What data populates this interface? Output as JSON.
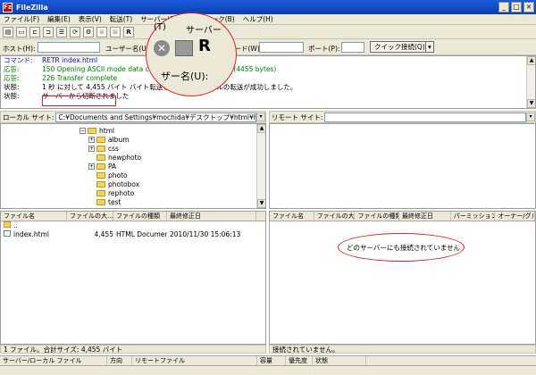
{
  "window": {
    "title": "FileZilla",
    "icon_text": "Fz",
    "buttons": [
      "_",
      "□",
      "×"
    ]
  },
  "menu": [
    "ファイル(F)",
    "編集(E)",
    "表示(V)",
    "転送(T)",
    "サーバー(S)",
    "ブックマーク(B)",
    "ヘルプ(H)"
  ],
  "toolbar": {
    "disconnect_letter": "R"
  },
  "quickconnect": {
    "host_label": "ホスト(H):",
    "user_label": "ユーザー名(U):",
    "pass_label": "パスワード(W):",
    "port_label": "ポート(P):",
    "button": "クイック接続(Q)"
  },
  "log": [
    {
      "kind": "コマンド:",
      "text": "RETR index.html",
      "class": "c-cmd"
    },
    {
      "kind": "応答:",
      "text": "150 Opening ASCII mode data connection for index.html (4455 bytes)",
      "class": "c-ok"
    },
    {
      "kind": "応答:",
      "text": "226 Transfer complete",
      "class": "c-ok"
    },
    {
      "kind": "状態:",
      "text": "1 秒 に対して 4,455 バイト バイト転送しました。ファイルの転送が成功しました。",
      "class": "c-st"
    },
    {
      "kind": "状態:",
      "text": "サーバーから切断されました",
      "class": "c-st"
    }
  ],
  "zoom": {
    "menu_hint": "(T)",
    "menu_title": "サーバー",
    "letter": "R",
    "caption": "ザー名(U):"
  },
  "local": {
    "site_label": "ローカル サイト:",
    "path": "C:¥Documents and Settings¥mochida¥デスクトップ¥html¥html¥test¥",
    "tree": [
      {
        "name": "html",
        "depth": 0,
        "expander": "−"
      },
      {
        "name": "album",
        "depth": 1,
        "expander": "+"
      },
      {
        "name": "css",
        "depth": 1,
        "expander": "+"
      },
      {
        "name": "newphoto",
        "depth": 1,
        "expander": ""
      },
      {
        "name": "PA",
        "depth": 1,
        "expander": "+"
      },
      {
        "name": "photo",
        "depth": 1,
        "expander": ""
      },
      {
        "name": "photobox",
        "depth": 1,
        "expander": ""
      },
      {
        "name": "rephoto",
        "depth": 1,
        "expander": ""
      },
      {
        "name": "test",
        "depth": 1,
        "expander": ""
      }
    ],
    "columns": [
      "ファイル名",
      "ファイルの大...",
      "ファイルの種類",
      "最終修正日"
    ],
    "files": [
      {
        "name": "..",
        "size": "",
        "type": "",
        "modified": ""
      },
      {
        "name": "index.html",
        "size": "4,455",
        "type": "HTML Document",
        "modified": "2010/11/30 15:06:13"
      }
    ],
    "status": "1 ファイル。合計サイズ: 4,455 バイト"
  },
  "remote": {
    "site_label": "リモート サイト:",
    "columns": [
      "ファイル名",
      "ファイルの大...",
      "ファイルの種類",
      "最終修正日",
      "パーミッション",
      "オーナー/グル"
    ],
    "empty_message": "どのサーバーにも接続されていません",
    "status": "接続されていません。"
  },
  "queue": {
    "columns": [
      "サーバー/ローカル ファイル",
      "方向",
      "リモートファイル",
      "容量",
      "優先度",
      "状態"
    ]
  },
  "colors": {
    "callout": "#e02020",
    "log_command": "#0000c0",
    "log_response": "#008000"
  }
}
